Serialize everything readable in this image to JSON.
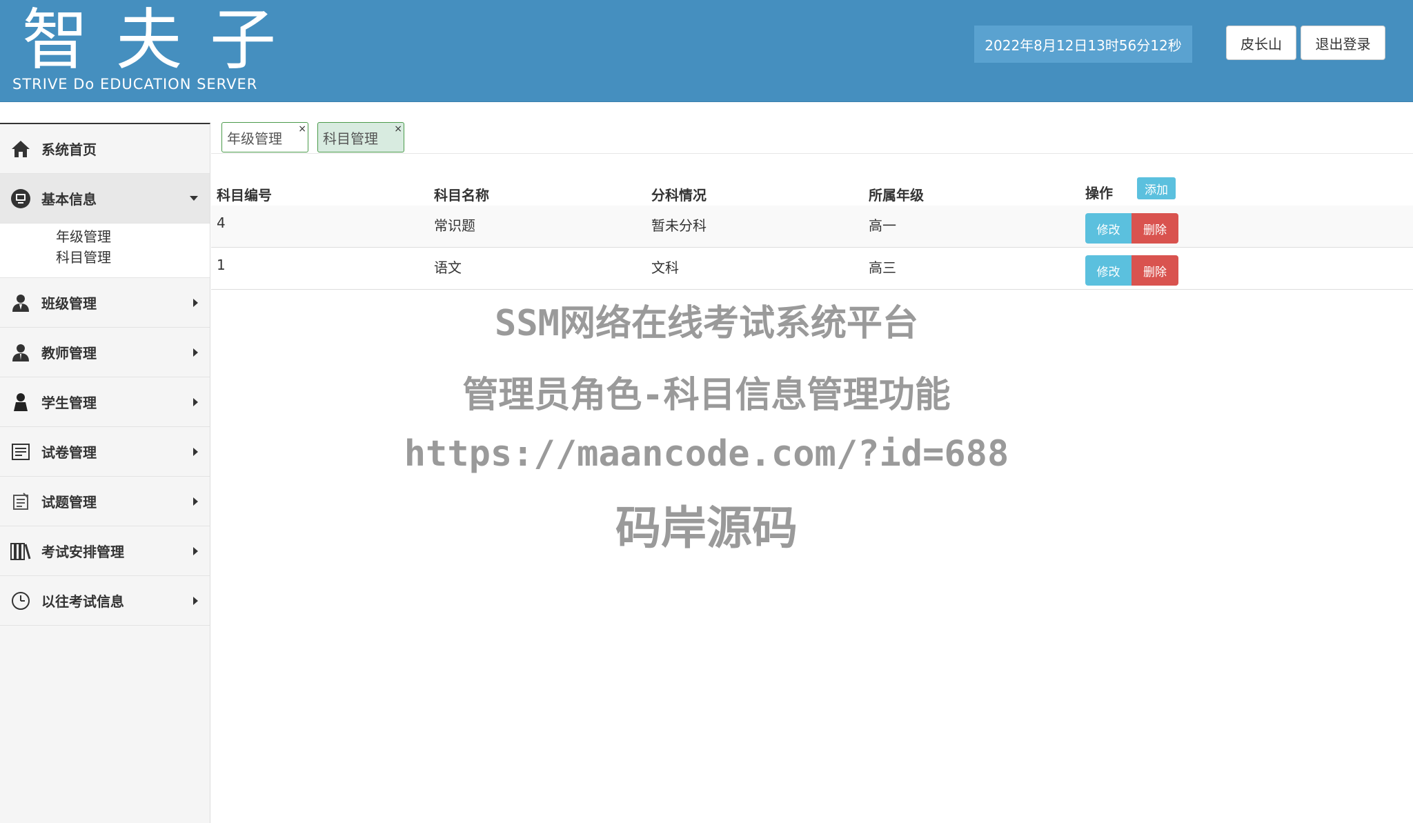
{
  "header": {
    "logo_main": "智夫子",
    "logo_sub": "STRIVE Do EDUCATION SERVER",
    "clock": "2022年8月12日13时56分12秒",
    "user_button": "皮长山",
    "logout_button": "退出登录",
    "bg_color": "#458fbf"
  },
  "sidebar": {
    "items": [
      {
        "label": "系统首页",
        "icon": "home-icon"
      },
      {
        "label": "基本信息",
        "icon": "monitor-icon",
        "expanded": true,
        "children": [
          {
            "label": "年级管理"
          },
          {
            "label": "科目管理"
          }
        ]
      },
      {
        "label": "班级管理",
        "icon": "user-group-icon"
      },
      {
        "label": "教师管理",
        "icon": "teacher-icon"
      },
      {
        "label": "学生管理",
        "icon": "student-icon"
      },
      {
        "label": "试卷管理",
        "icon": "document-icon"
      },
      {
        "label": "试题管理",
        "icon": "notepad-icon"
      },
      {
        "label": "考试安排管理",
        "icon": "books-icon"
      },
      {
        "label": "以往考试信息",
        "icon": "clock-icon"
      }
    ]
  },
  "tabs": [
    {
      "label": "年级管理",
      "close": "×",
      "active": false
    },
    {
      "label": "科目管理",
      "close": "×",
      "active": true
    }
  ],
  "table": {
    "columns": [
      "科目编号",
      "科目名称",
      "分科情况",
      "所属年级",
      "操作"
    ],
    "add_button": "添加",
    "edit_button": "修改",
    "delete_button": "删除",
    "rows": [
      {
        "id": "4",
        "name": "常识题",
        "division": "暂未分科",
        "grade": "高一"
      },
      {
        "id": "1",
        "name": "语文",
        "division": "文科",
        "grade": "高三"
      }
    ]
  },
  "watermark": {
    "line1": "SSM网络在线考试系统平台",
    "line2": "管理员角色-科目信息管理功能",
    "line3": "https://maancode.com/?id=688",
    "line4": "码岸源码"
  }
}
